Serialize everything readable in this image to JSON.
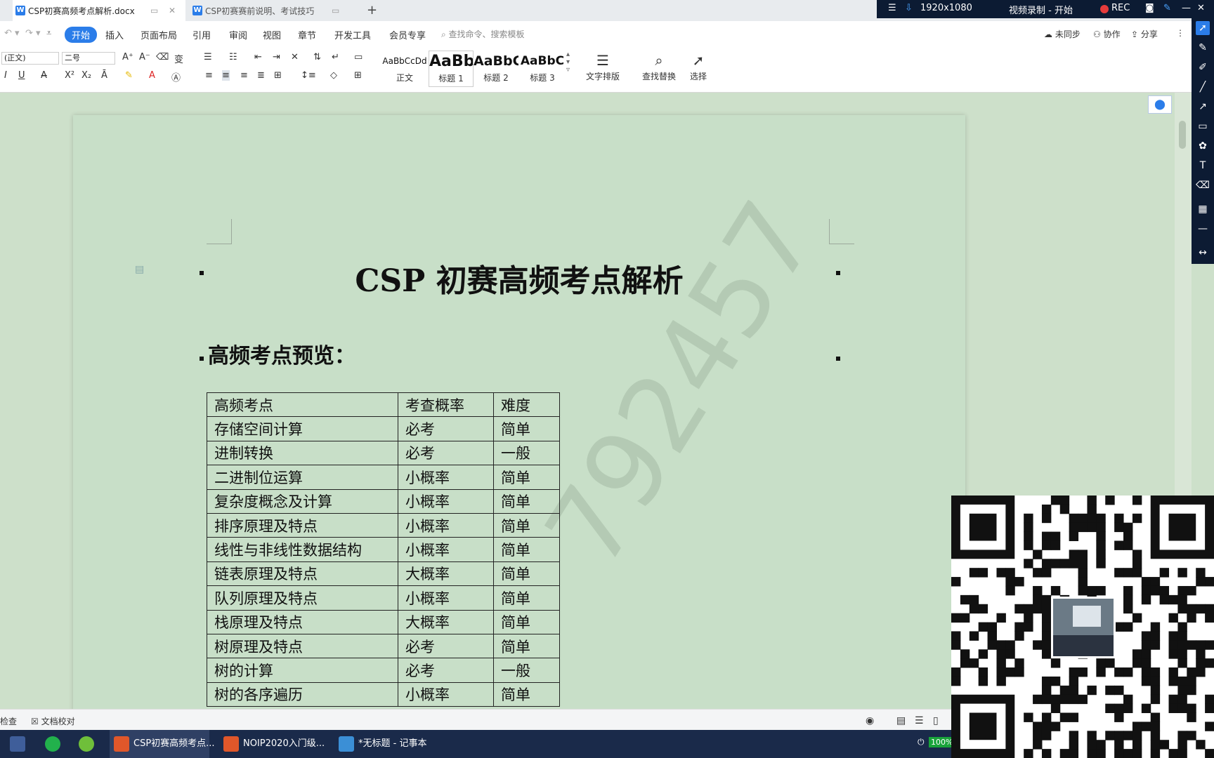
{
  "tabs": [
    {
      "title": "CSP初赛高频考点解析.docx",
      "active": true
    },
    {
      "title": "CSP初赛赛前说明、考试技巧",
      "active": false
    }
  ],
  "rec_bar": {
    "resolution": "1920x1080",
    "status": "视频录制 - 开始",
    "rec_label": "REC"
  },
  "menu": [
    "开始",
    "插入",
    "页面布局",
    "引用",
    "审阅",
    "视图",
    "章节",
    "开发工具",
    "会员专享"
  ],
  "search_placeholder": "查找命令、搜索模板",
  "right_tools": {
    "sync": "未同步",
    "collab": "协作",
    "share": "分享"
  },
  "font": {
    "name": "(正文)",
    "size": "二号"
  },
  "styles": [
    {
      "preview": "AaBbCcDd",
      "label": "正文"
    },
    {
      "preview": "AaBb",
      "label": "标题 1"
    },
    {
      "preview": "AaBbC",
      "label": "标题 2"
    },
    {
      "preview": "AaBbC",
      "label": "标题 3"
    }
  ],
  "big_tools": {
    "layout": "文字排版",
    "find": "查找替换",
    "select": "选择"
  },
  "document": {
    "title": "CSP 初赛高频考点解析",
    "heading": "高频考点预览：",
    "watermark": "792457",
    "table": {
      "header": [
        "高频考点",
        "考查概率",
        "难度"
      ],
      "rows": [
        [
          "存储空间计算",
          "必考",
          "简单"
        ],
        [
          "进制转换",
          "必考",
          "一般"
        ],
        [
          "二进制位运算",
          "小概率",
          "简单"
        ],
        [
          "复杂度概念及计算",
          "小概率",
          "简单"
        ],
        [
          "排序原理及特点",
          "小概率",
          "简单"
        ],
        [
          "线性与非线性数据结构",
          "小概率",
          "简单"
        ],
        [
          "链表原理及特点",
          "大概率",
          "简单"
        ],
        [
          "队列原理及特点",
          "小概率",
          "简单"
        ],
        [
          "栈原理及特点",
          "大概率",
          "简单"
        ],
        [
          "树原理及特点",
          "必考",
          "简单"
        ],
        [
          "树的计算",
          "必考",
          "一般"
        ],
        [
          "树的各序遍历",
          "小概率",
          "简单"
        ]
      ]
    }
  },
  "status": {
    "check": "检查",
    "proof": "文档校对"
  },
  "taskbar": [
    {
      "label": "CSP初赛高频考点...",
      "color": "#e0572a"
    },
    {
      "label": "NOIP2020入门级...",
      "color": "#e0572a"
    },
    {
      "label": "*无标题 - 记事本",
      "color": "#3b8fd6"
    }
  ],
  "battery": "100%"
}
